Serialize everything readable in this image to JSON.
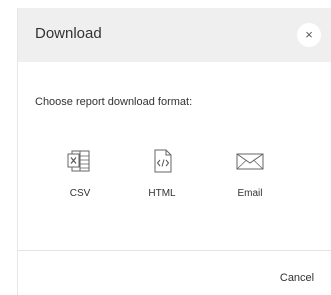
{
  "dialog": {
    "title": "Download",
    "close_glyph": "×",
    "prompt": "Choose report download format:",
    "options": [
      {
        "label": "CSV",
        "icon": "csv-file-icon"
      },
      {
        "label": "HTML",
        "icon": "html-file-icon"
      },
      {
        "label": "Email",
        "icon": "envelope-icon"
      }
    ],
    "cancel_label": "Cancel"
  },
  "colors": {
    "header_bg": "#efefef",
    "text": "#333333",
    "icon_stroke": "#666666"
  }
}
